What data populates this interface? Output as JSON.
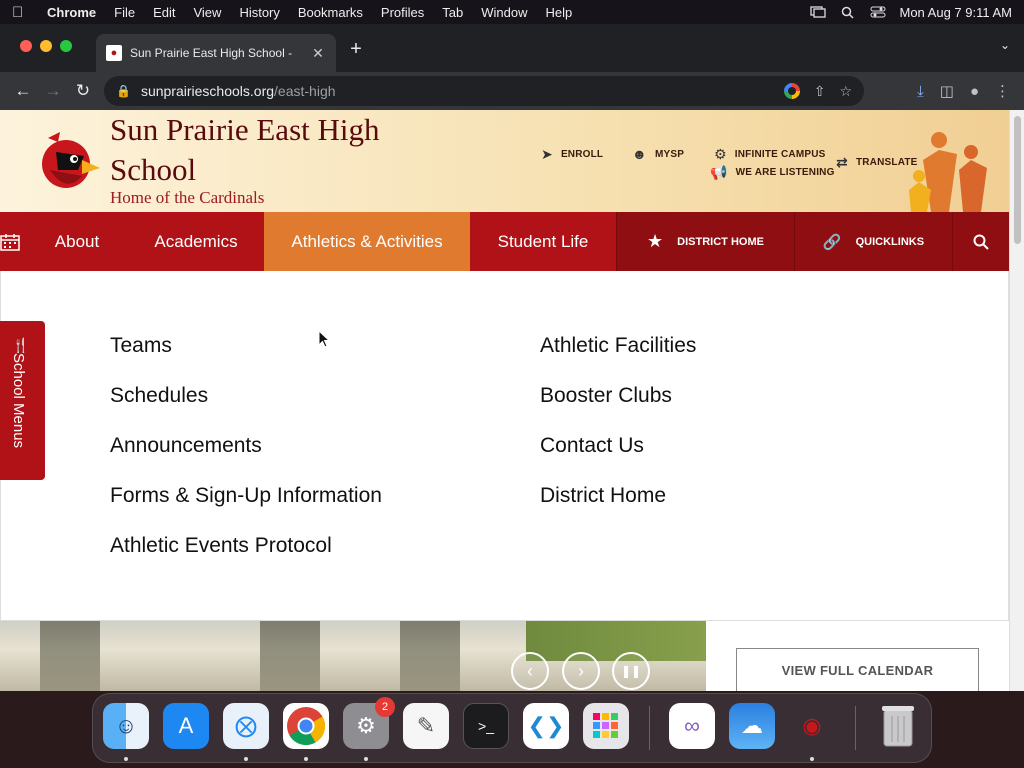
{
  "menubar": {
    "app": "Chrome",
    "items": [
      "File",
      "Edit",
      "View",
      "History",
      "Bookmarks",
      "Profiles",
      "Tab",
      "Window",
      "Help"
    ],
    "datetime": "Mon Aug 7  9:11 AM"
  },
  "browser": {
    "tab_title": "Sun Prairie East High School -",
    "url_host": "sunprairieschools.org",
    "url_path": "/east-high"
  },
  "site": {
    "school_name": "Sun Prairie East High School",
    "tagline": "Home of the Cardinals",
    "utility": {
      "enroll": "ENROLL",
      "mysp": "MYSP",
      "infinite_campus": "INFINITE CAMPUS",
      "we_are_listening": "WE ARE LISTENING",
      "translate": "TRANSLATE"
    },
    "nav": {
      "about": "About",
      "academics": "Academics",
      "athletics": "Athletics & Activities",
      "student_life": "Student Life",
      "district_home": "DISTRICT HOME",
      "quicklinks": "QUICKLINKS"
    },
    "dropdown": {
      "left": [
        "Teams",
        "Schedules",
        "Announcements",
        "Forms & Sign-Up Information",
        "Athletic Events Protocol"
      ],
      "right": [
        "Athletic Facilities",
        "Booster Clubs",
        "Contact Us",
        "District Home"
      ]
    },
    "side_tab": "School Menus",
    "calendar_button": "VIEW FULL CALENDAR"
  },
  "dock": {
    "apps": [
      "Finder",
      "App Store",
      "Safari",
      "Chrome",
      "System Settings",
      "TextEdit",
      "Terminal",
      "VS Code",
      "Launchpad",
      "Visual Studio",
      "Weather",
      "Package",
      "Trash"
    ],
    "settings_badge": "2"
  },
  "colors": {
    "nav_red": "#b01217",
    "nav_active": "#e07a2f",
    "nav_dark": "#8e0e12"
  }
}
